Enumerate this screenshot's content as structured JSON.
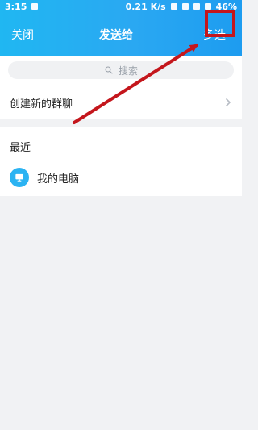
{
  "status_bar": {
    "time": "3:15",
    "network_speed": "0.21 K/s",
    "battery": "46%"
  },
  "nav": {
    "close_label": "关闭",
    "title": "发送给",
    "multi_select_label": "多选"
  },
  "search": {
    "placeholder": "搜索"
  },
  "create_group": {
    "label": "创建新的群聊"
  },
  "recent": {
    "header": "最近",
    "items": [
      {
        "name": "我的电脑"
      }
    ]
  },
  "colors": {
    "accent_blue": "#2aa8f2",
    "annotation_red": "#c4161c"
  }
}
